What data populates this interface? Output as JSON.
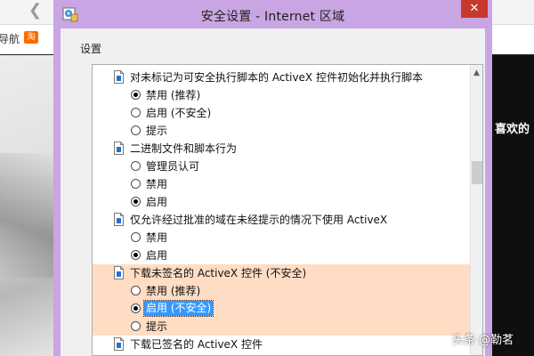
{
  "background": {
    "nav_text": "导航",
    "favicon_text": "淘",
    "right_text": "喜欢的",
    "watermark": "头条 @勒茗"
  },
  "dialog": {
    "title": "安全设置 - Internet 区域",
    "close_glyph": "✕",
    "group_label": "设置",
    "rows": [
      {
        "kind": "cat",
        "label": "对未标记为可安全执行脚本的 ActiveX 控件初始化并执行脚本"
      },
      {
        "kind": "opt",
        "label": "禁用 (推荐)",
        "checked": true
      },
      {
        "kind": "opt",
        "label": "启用 (不安全)",
        "checked": false
      },
      {
        "kind": "opt",
        "label": "提示",
        "checked": false
      },
      {
        "kind": "cat",
        "label": "二进制文件和脚本行为"
      },
      {
        "kind": "opt",
        "label": "管理员认可",
        "checked": false
      },
      {
        "kind": "opt",
        "label": "禁用",
        "checked": false
      },
      {
        "kind": "opt",
        "label": "启用",
        "checked": true
      },
      {
        "kind": "cat",
        "label": "仅允许经过批准的域在未经提示的情况下使用 ActiveX"
      },
      {
        "kind": "opt",
        "label": "禁用",
        "checked": false
      },
      {
        "kind": "opt",
        "label": "启用",
        "checked": true
      },
      {
        "kind": "cat",
        "label": "下载未签名的 ActiveX 控件 (不安全)",
        "highlight": true
      },
      {
        "kind": "opt",
        "label": "禁用 (推荐)",
        "checked": false,
        "highlight": true
      },
      {
        "kind": "opt",
        "label": "启用 (不安全)",
        "checked": true,
        "highlight": true,
        "selected": true
      },
      {
        "kind": "opt",
        "label": "提示",
        "checked": false,
        "highlight": true
      },
      {
        "kind": "cat",
        "label": "下载已签名的 ActiveX 控件"
      }
    ]
  },
  "colors": {
    "dialog_frame": "#c9a6e3",
    "highlight_group": "#ffdcc4",
    "selection": "#3399ff",
    "close_button": "#c7382c"
  },
  "icons": {
    "app": "security-settings-icon",
    "category": "script-page-icon",
    "scroll_up": "chevron-up-icon"
  }
}
